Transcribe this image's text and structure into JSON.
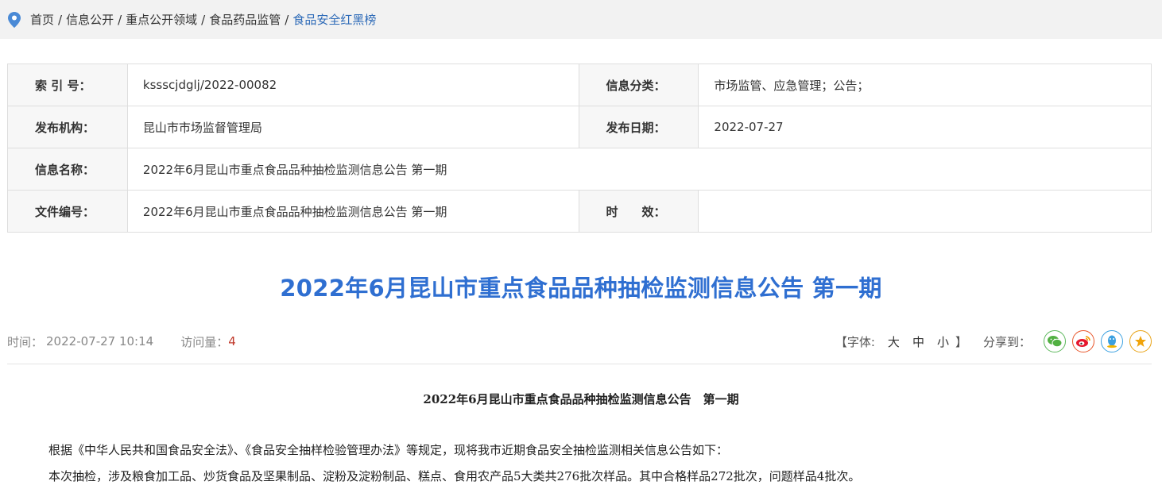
{
  "breadcrumb": {
    "items": [
      "首页",
      "信息公开",
      "重点公开领域",
      "食品药品监管"
    ],
    "current": "食品安全红黑榜",
    "separator": "/"
  },
  "info": {
    "index_label": "索 引 号：",
    "index_value": "kssscjdglj/2022-00082",
    "category_label": "信息分类：",
    "category_value": "市场监管、应急管理；公告；",
    "publisher_label": "发布机构：",
    "publisher_value": "昆山市市场监督管理局",
    "date_label": "发布日期：",
    "date_value": "2022-07-27",
    "name_label": "信息名称：",
    "name_value": "2022年6月昆山市重点食品品种抽检监测信息公告 第一期",
    "docno_label": "文件编号：",
    "docno_value": "2022年6月昆山市重点食品品种抽检监测信息公告 第一期",
    "validity_label": "时　　效：",
    "validity_value": ""
  },
  "title": "2022年6月昆山市重点食品品种抽检监测信息公告 第一期",
  "meta": {
    "time_label": "时间：",
    "time_value": "2022-07-27 10:14",
    "visits_label": "访问量：",
    "visits_value": "4",
    "font_open": "【",
    "font_label": "字体:",
    "font_large": "大",
    "font_medium": "中",
    "font_small": "小",
    "font_close": "】",
    "share_label": "分享到："
  },
  "icons": {
    "location": "map-pin-icon",
    "share": [
      "wechat-icon",
      "weibo-icon",
      "qq-icon",
      "favorite-icon"
    ]
  },
  "colors": {
    "title": "#2f6fd1",
    "breadcrumb_current": "#2e6bb8",
    "visits": "#c0392b"
  },
  "content": {
    "heading": "2022年6月昆山市重点食品品种抽检监测信息公告　第一期",
    "paragraphs": [
      "根据《中华人民共和国食品安全法》、《食品安全抽样检验管理办法》等规定，现将我市近期食品安全抽检监测相关信息公告如下：",
      "本次抽检，涉及粮食加工品、炒货食品及坚果制品、淀粉及淀粉制品、糕点、食用农产品5大类共276批次样品。其中合格样品272批次，问题样品4批次。"
    ]
  }
}
